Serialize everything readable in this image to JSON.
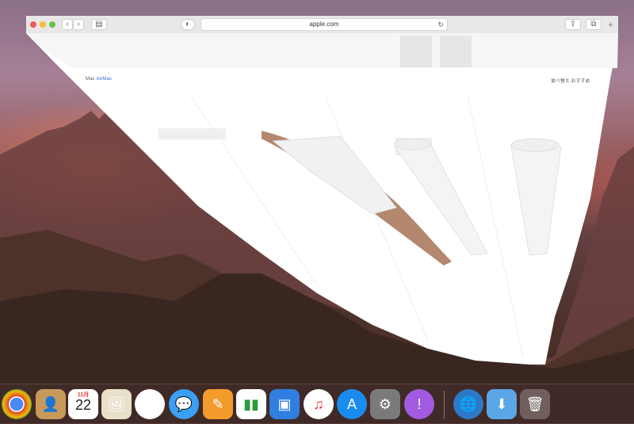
{
  "browser": {
    "url": "apple.com",
    "nav_left_label": "Mac",
    "nav_left_secondary": "AirMac",
    "sort_label": "並べ替え おすすめ"
  },
  "dock": {
    "calendar_month": "11月",
    "calendar_day": "22",
    "icons": [
      "chrome",
      "contacts",
      "calendar",
      "preview",
      "photos",
      "messages",
      "pages",
      "numbers",
      "keynote",
      "itunes",
      "app-store",
      "system-preferences",
      "notification",
      "safari",
      "downloads-folder",
      "trash"
    ]
  },
  "colors": {
    "close": "#ee5b55",
    "minimize": "#f5bd3a",
    "maximize": "#5fc54a"
  }
}
